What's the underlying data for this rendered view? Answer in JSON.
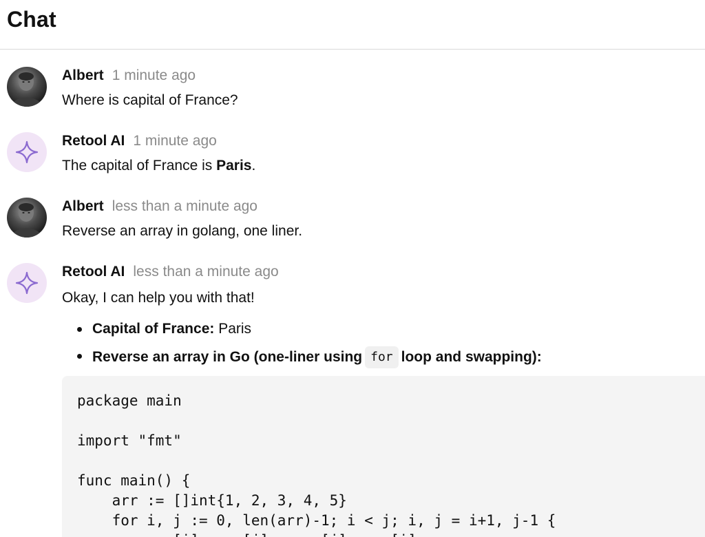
{
  "header": {
    "title": "Chat"
  },
  "messages": [
    {
      "author": "Albert",
      "time": "1 minute ago",
      "avatar": "user-photo",
      "text": "Where is capital of France?"
    },
    {
      "author": "Retool AI",
      "time": "1 minute ago",
      "avatar": "sparkle-icon",
      "text_before": "The capital of France is ",
      "text_bold": "Paris",
      "text_after": "."
    },
    {
      "author": "Albert",
      "time": "less than a minute ago",
      "avatar": "user-photo",
      "text": "Reverse an array in golang, one liner."
    },
    {
      "author": "Retool AI",
      "time": "less than a minute ago",
      "avatar": "sparkle-icon",
      "text": "Okay, I can help you with that!",
      "bullets": [
        {
          "label": "Capital of France:",
          "value": " Paris"
        },
        {
          "label_before": "Reverse an array in Go (one-liner using",
          "code": "for",
          "label_after": "loop and swapping):"
        }
      ],
      "code_lines": [
        "package main",
        "",
        "import \"fmt\"",
        "",
        "func main() {",
        "    arr := []int{1, 2, 3, 4, 5}",
        "    for i, j := 0, len(arr)-1; i < j; i, j = i+1, j-1 {",
        "        arr[i], arr[j] = arr[j], arr[i]"
      ]
    }
  ],
  "colors": {
    "accent_purple": "#8b6ad0",
    "ai_avatar_bg": "#f1e4f6",
    "muted_text": "#8a8a8a",
    "code_bg": "#f4f4f4"
  }
}
